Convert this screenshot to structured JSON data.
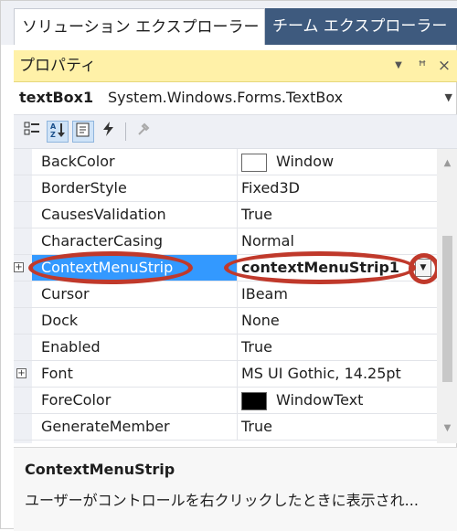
{
  "tabs": {
    "solution_explorer": "ソリューション エクスプローラー",
    "team_explorer": "チーム エクスプローラー"
  },
  "panel": {
    "title": "プロパティ",
    "dropdown_icon": "▼",
    "pin_icon": "ꟸ",
    "close_icon": "×"
  },
  "object_selector": {
    "name": "textBox1",
    "type": "System.Windows.Forms.TextBox"
  },
  "toolbar": {
    "buttons": [
      "categorized-icon",
      "alphabetical-icon",
      "properties-icon",
      "events-icon",
      "property-pages-icon"
    ]
  },
  "properties": [
    {
      "name": "BackColor",
      "value": "Window",
      "swatch": "#ffffff"
    },
    {
      "name": "BorderStyle",
      "value": "Fixed3D"
    },
    {
      "name": "CausesValidation",
      "value": "True"
    },
    {
      "name": "CharacterCasing",
      "value": "Normal"
    },
    {
      "name": "ContextMenuStrip",
      "value": "contextMenuStrip1",
      "selected": true
    },
    {
      "name": "Cursor",
      "value": "IBeam"
    },
    {
      "name": "Dock",
      "value": "None"
    },
    {
      "name": "Enabled",
      "value": "True"
    },
    {
      "name": "Font",
      "value": "MS UI Gothic, 14.25pt"
    },
    {
      "name": "ForeColor",
      "value": "WindowText",
      "swatch": "#000000"
    },
    {
      "name": "GenerateMember",
      "value": "True"
    }
  ],
  "description": {
    "title": "ContextMenuStrip",
    "text": "ユーザーがコントロールを右クリックしたときに表示され..."
  },
  "colors": {
    "title_bar": "#fff1a8",
    "selection": "#3399ff",
    "annotation": "#c0392b",
    "inactive_tab": "#3e5a7e"
  }
}
